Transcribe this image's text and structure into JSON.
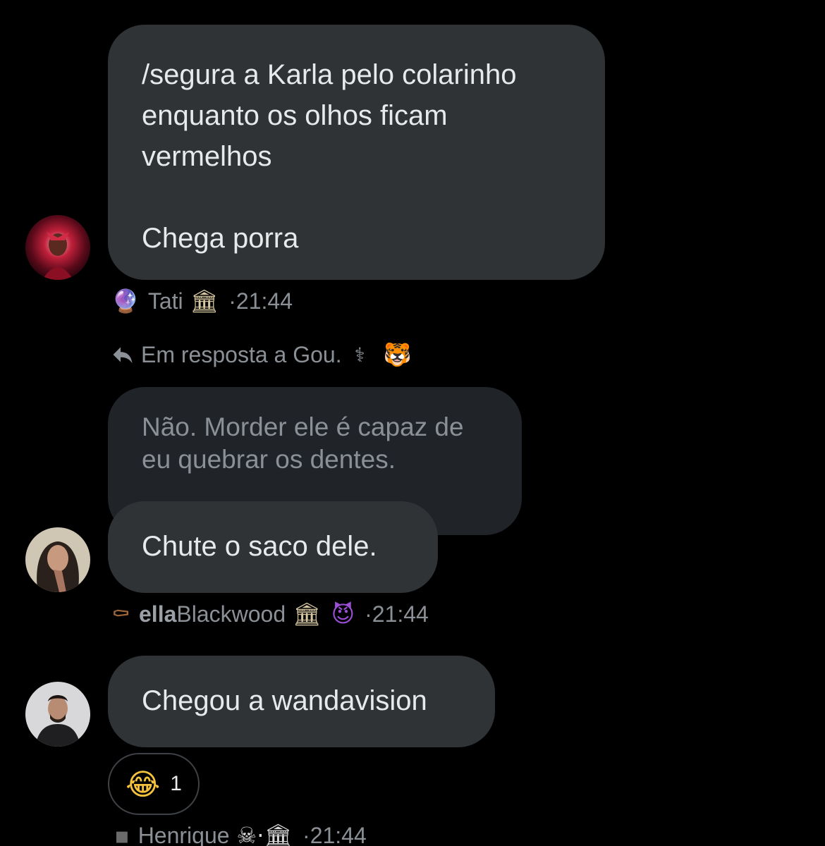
{
  "messages": [
    {
      "text": "/segura a Karla pelo colarinho\nenquanto os olhos ficam\nvermelhos\n\nChega porra",
      "sender": {
        "prefix_emoji": "🔮",
        "name": "Tati",
        "suffix": "🏛",
        "time": "·21:44"
      }
    },
    {
      "reply_to": {
        "label": "Em resposta a Gou.",
        "emoji_1": "⚕",
        "emoji_2": "🐯"
      },
      "quoted_text": "Não. Morder ele é capaz de\neu quebrar os dentes.",
      "text": "Chute o saco dele.",
      "sender": {
        "prefix_emoji": "⚰",
        "name_bold": "ella",
        "name_rest": "Blackwood",
        "suffix": "🏛",
        "suffix_2": "😈",
        "time": "·21:44"
      }
    },
    {
      "text": "Chegou a wandavision",
      "reaction": {
        "emoji": "😂",
        "count": "1"
      },
      "sender": {
        "prefix_emoji": "▪",
        "name": "Henrique",
        "suffix": "☠·🏛",
        "time": "·21:44"
      }
    }
  ],
  "colors": {
    "bubble": "#2f3336",
    "text": "#e7e9ea",
    "muted": "#8b9096",
    "background": "#000000"
  }
}
